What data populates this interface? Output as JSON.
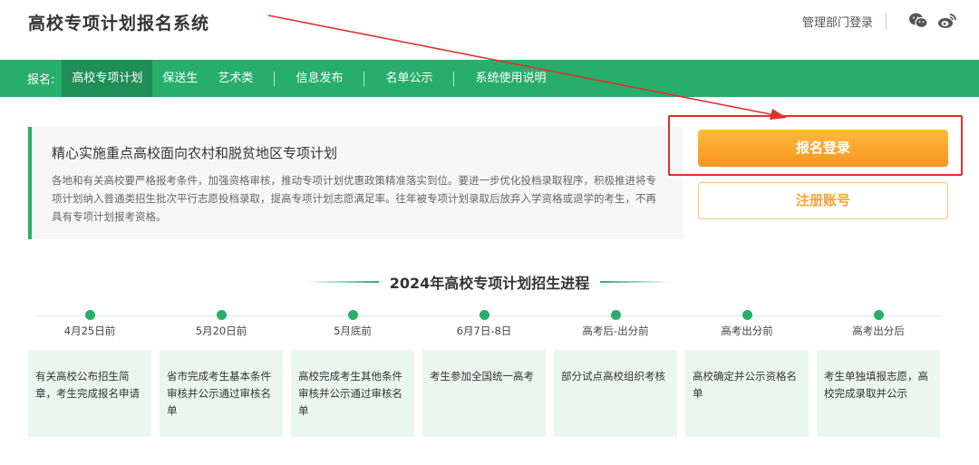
{
  "header": {
    "site_title": "高校专项计划报名系统",
    "admin_login": "管理部门登录",
    "icons": [
      "wechat-icon",
      "weibo-icon"
    ]
  },
  "nav": {
    "prefix": "报名:",
    "items": [
      {
        "label": "高校专项计划",
        "active": true
      },
      {
        "label": "保送生"
      },
      {
        "label": "艺术类"
      },
      {
        "label": "信息发布"
      },
      {
        "label": "名单公示"
      },
      {
        "label": "系统使用说明"
      }
    ]
  },
  "intro": {
    "title": "精心实施重点高校面向农村和脱贫地区专项计划",
    "text": "各地和有关高校要严格报考条件，加强资格审核，推动专项计划优惠政策精准落实到位。要进一步优化投档录取程序，积极推进将专项计划纳入普通类招生批次平行志愿投档录取，提高专项计划志愿满足率。往年被专项计划录取后放弃入学资格或退学的考生，不再具有专项计划报考资格。"
  },
  "actions": {
    "login_label": "报名登录",
    "register_label": "注册账号"
  },
  "progress": {
    "title": "2024年高校专项计划招生进程",
    "stages": [
      {
        "date": "4月25日前",
        "desc": "有关高校公布招生简章，考生完成报名申请"
      },
      {
        "date": "5月20日前",
        "desc": "省市完成考生基本条件审核并公示通过审核名单"
      },
      {
        "date": "5月底前",
        "desc": "高校完成考生其他条件审核并公示通过审核名单"
      },
      {
        "date": "6月7日-8日",
        "desc": "考生参加全国统一高考"
      },
      {
        "date": "高考后-出分前",
        "desc": "部分试点高校组织考核"
      },
      {
        "date": "高考出分前",
        "desc": "高校确定并公示资格名单"
      },
      {
        "date": "高考出分后",
        "desc": "考生单独填报志愿，高校完成录取并公示"
      }
    ]
  },
  "colors": {
    "brand_green": "#27ae6b",
    "orange": "#f7951e",
    "highlight_red": "#e0302a"
  }
}
